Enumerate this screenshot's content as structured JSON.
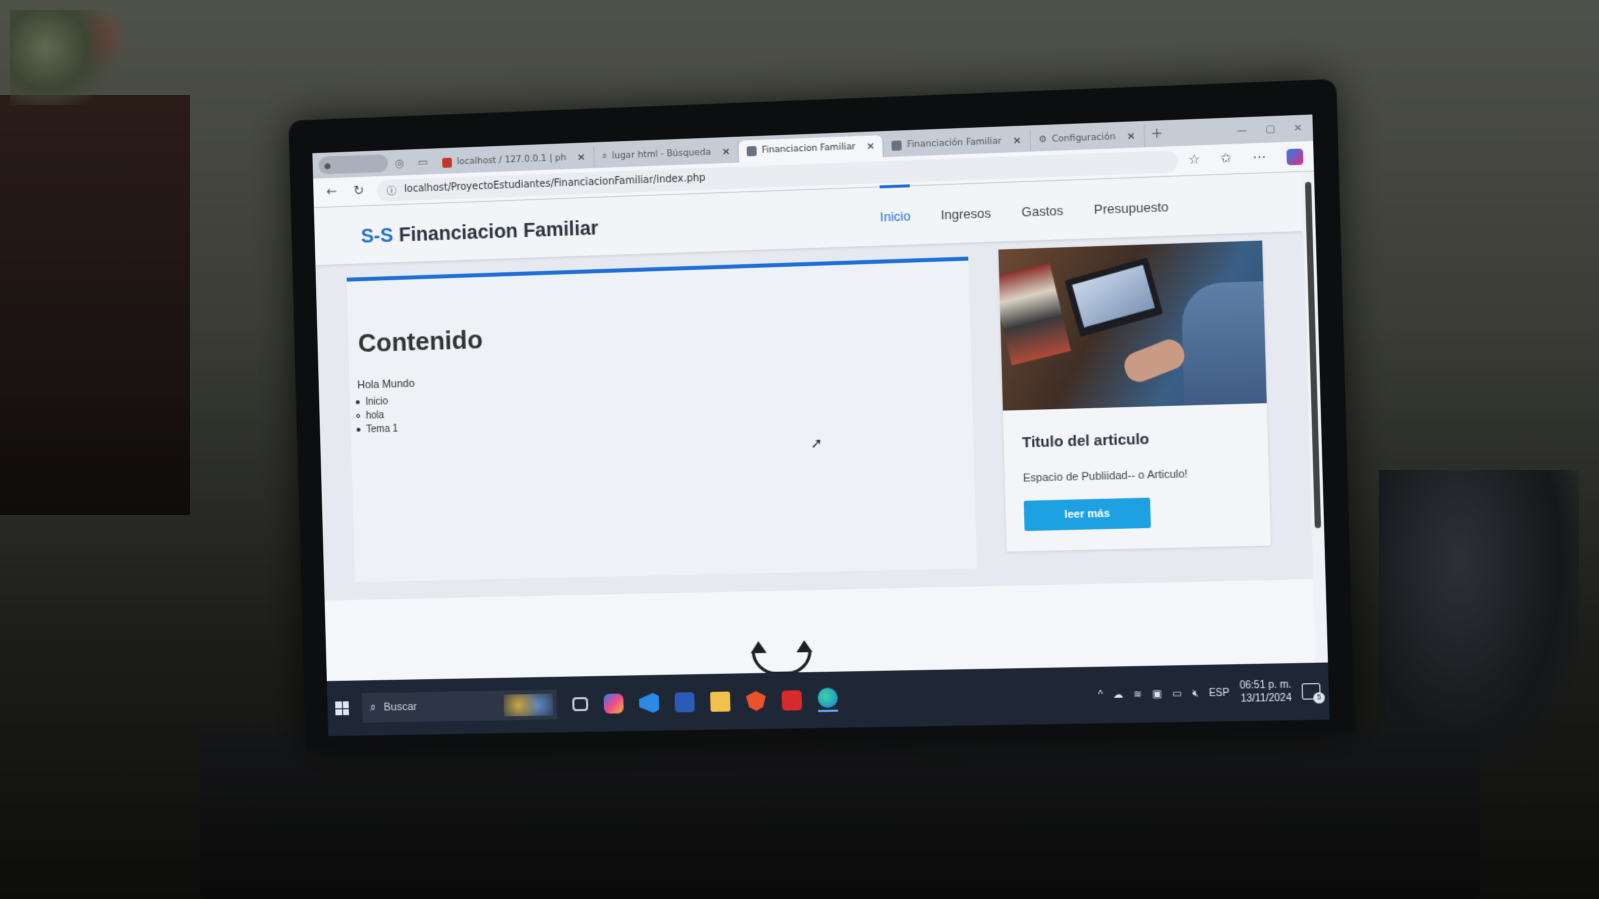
{
  "browser": {
    "tabs": [
      {
        "label": "localhost / 127.0.0.1 | ph",
        "icon": "phpmyadmin-icon"
      },
      {
        "label": "lugar html - Búsqueda",
        "icon": "search-icon"
      },
      {
        "label": "Financiacion Familiar",
        "icon": "site-icon",
        "active": true
      },
      {
        "label": "Financiación Familiar",
        "icon": "site-icon"
      },
      {
        "label": "Configuración",
        "icon": "gear-icon"
      }
    ],
    "url": "localhost/ProyectoEstudiantes/FinanciacionFamiliar/index.php"
  },
  "site": {
    "brand_accent": "S-S",
    "brand_name": "Financiacion Familiar",
    "menu": [
      {
        "label": "Inicio",
        "current": true
      },
      {
        "label": "Ingresos"
      },
      {
        "label": "Gastos"
      },
      {
        "label": "Presupuesto"
      }
    ],
    "main": {
      "title": "Contenido",
      "greeting": "Hola Mundo",
      "list": [
        {
          "text": "Inicio",
          "style": "disc"
        },
        {
          "text": "hola",
          "style": "circle"
        },
        {
          "text": "Tema 1",
          "style": "disc"
        }
      ]
    },
    "article": {
      "title": "Titulo del articulo",
      "description": "Espacio de Publiidad-- o Articulo!",
      "button": "leer más"
    }
  },
  "taskbar": {
    "search_placeholder": "Buscar",
    "language": "ESP",
    "time": "06:51 p. m.",
    "date": "13/11/2024",
    "notification_count": "5"
  },
  "colors": {
    "accent": "#1f6fd6",
    "button": "#1ea1e3",
    "taskbar": "#1e2735"
  }
}
